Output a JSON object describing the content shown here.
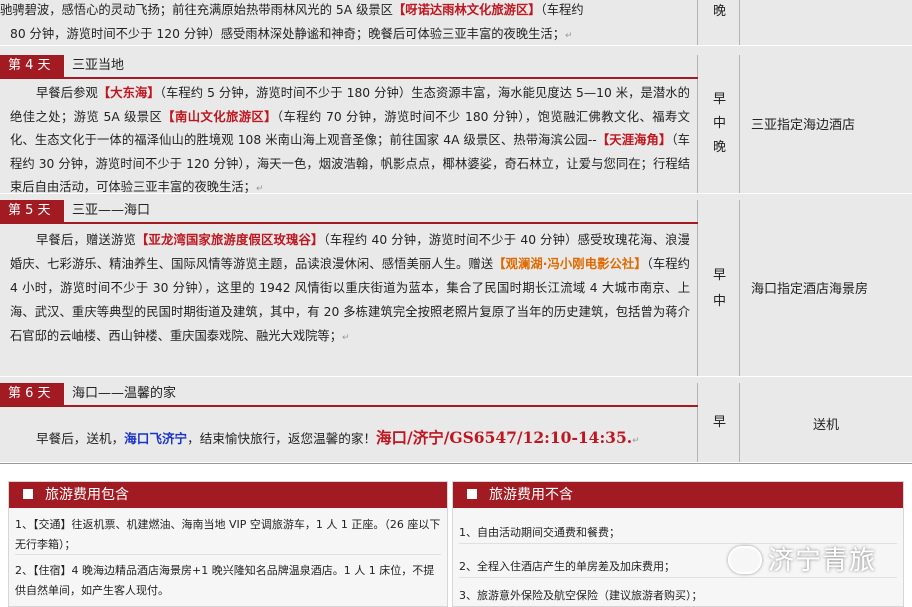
{
  "day3": {
    "line1_a": "驰骋碧波，感悟心的灵动飞扬；前往充满原始热带雨林风光的 5A 级景区",
    "line1_hl": "【呀诺达雨林文化旅游区】",
    "line1_b": "（车程约",
    "line2": "80 分钟，游览时间不少于 120 分钟）感受雨林深处静谧和神奇；晚餐后可体验三亚丰富的夜晚生活；",
    "meal": "晚"
  },
  "day4": {
    "badge": "第 4 天",
    "title": "三亚当地",
    "p_a": "早餐后参观",
    "hl1": "【大东海】",
    "p_b": "（车程约 5 分钟，游览时间不少于 180 分钟）生态资源丰富，海水能见度达 5—10 米，是潜水的绝佳之处；游览 5A 级景区",
    "hl2": "【南山文化旅游区】",
    "p_c": "（车程约 70 分钟，游览时间不少 180 分钟），饱览融汇佛教文化、福寿文化、生态文化于一体的福泽仙山的胜境观 108 米南山海上观音圣像；前往国家 4A 级景区、热带海滨公园--",
    "hl3": "【天涯海角】",
    "p_d": "（车程约 30 分钟，游览时间不少于 120 分钟），海天一色，烟波浩翰，帆影点点，椰林婆娑，奇石林立，让爱与您同在；行程结束后自由活动，可体验三亚丰富的夜晚生活；",
    "meals": [
      "早",
      "中",
      "晚"
    ],
    "hotel": "三亚指定海边酒店"
  },
  "day5": {
    "badge": "第 5 天",
    "title": "三亚——海口",
    "p_a": "早餐后，赠送游览",
    "hl1": "【亚龙湾国家旅游度假区玫瑰谷】",
    "p_b": "（车程约 40 分钟，游览时间不少于 40 分钟）感受玫瑰花海、浪漫婚庆、七彩游乐、精油养生、国际风情等游览主题，品读浪漫休闲、感悟美丽人生。赠送",
    "hl2": "【观澜湖·冯小刚电影公社】",
    "p_c": "（车程约 4 小时，游览时间不少于 30 分钟），这里的 1942 风情街以重庆街道为蓝本，集合了民国时期长江流域 4 大城市南京、上海、武汉、重庆等典型的民国时期街道及建筑，其中，有 20 多栋建筑完全按照老照片复原了当年的历史建筑，包括曾为蒋介石官邸的云岫楼、西山钟楼、重庆国泰戏院、融光大戏院等；",
    "meals": [
      "早",
      "中"
    ],
    "hotel": "海口指定酒店海景房"
  },
  "day6": {
    "badge": "第 6 天",
    "title": "海口——温馨的家",
    "p_a": "早餐后，送机，",
    "blue": "海口飞济宁",
    "p_b": "，结束愉快旅行，返您温馨的家！",
    "flight": "海口/济宁/GS6547/12:10-14:35.",
    "meal": "早",
    "hotel": "送机"
  },
  "include": {
    "title": "旅游费用包含",
    "items": [
      "1、【交通】往返机票、机建燃油、海南当地 VIP 空调旅游车，1 人 1 正座。（26 座以下无行李箱）；",
      "2、【住宿】4 晚海边精品酒店海景房+1 晚兴隆知名品牌温泉酒店。1 人 1 床位，不提供自然单间，如产生客人现付。"
    ]
  },
  "exclude": {
    "title": "旅游费用不含",
    "items": [
      "1、自由活动期间交通费和餐费；",
      "2、全程入住酒店产生的单房差及加床费用；",
      "3、旅游意外保险及航空保险（建议旅游者购买）；"
    ]
  },
  "watermark": "济宁青旅",
  "icons": {
    "paragraph_mark": "↵",
    "bullet": "square",
    "watermark_logo": "wechat-icon"
  },
  "colors": {
    "accent": "#a31b22",
    "highlight": "#c0161f",
    "orange": "#e06a00",
    "blue": "#1a33c8"
  }
}
